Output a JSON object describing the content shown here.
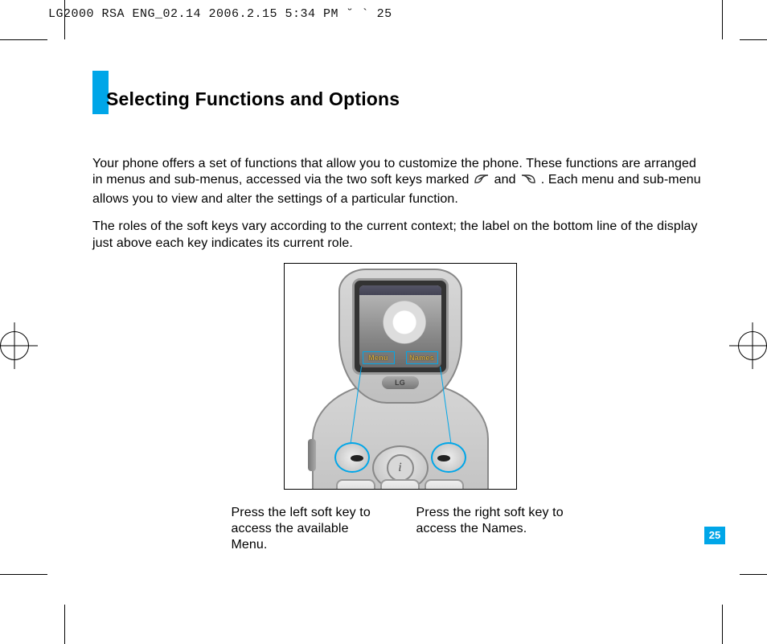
{
  "doc_header": "LG2000 RSA ENG_02.14  2006.2.15 5:34 PM  ˘  ` 25",
  "title": "Selecting Functions and Options",
  "para1a": "Your phone offers a set of functions that allow you to customize the phone. These functions are arranged in menus and sub-menus, accessed via the two soft keys marked ",
  "para1b": " and ",
  "para1c": " . Each menu and sub-menu allows you to view and alter the settings of a particular function.",
  "para2": "The roles of the soft keys vary according to the current context; the label on the bottom line of the display just above each key indicates its current role.",
  "phone_brand": "LG",
  "screen_softkey_left": "Menu",
  "screen_softkey_right": "Names",
  "nav_center_glyph": "i",
  "caption_left": "Press the left soft key to access the available Menu.",
  "caption_right": "Press the right soft key to access the Names.",
  "page_number": "25"
}
